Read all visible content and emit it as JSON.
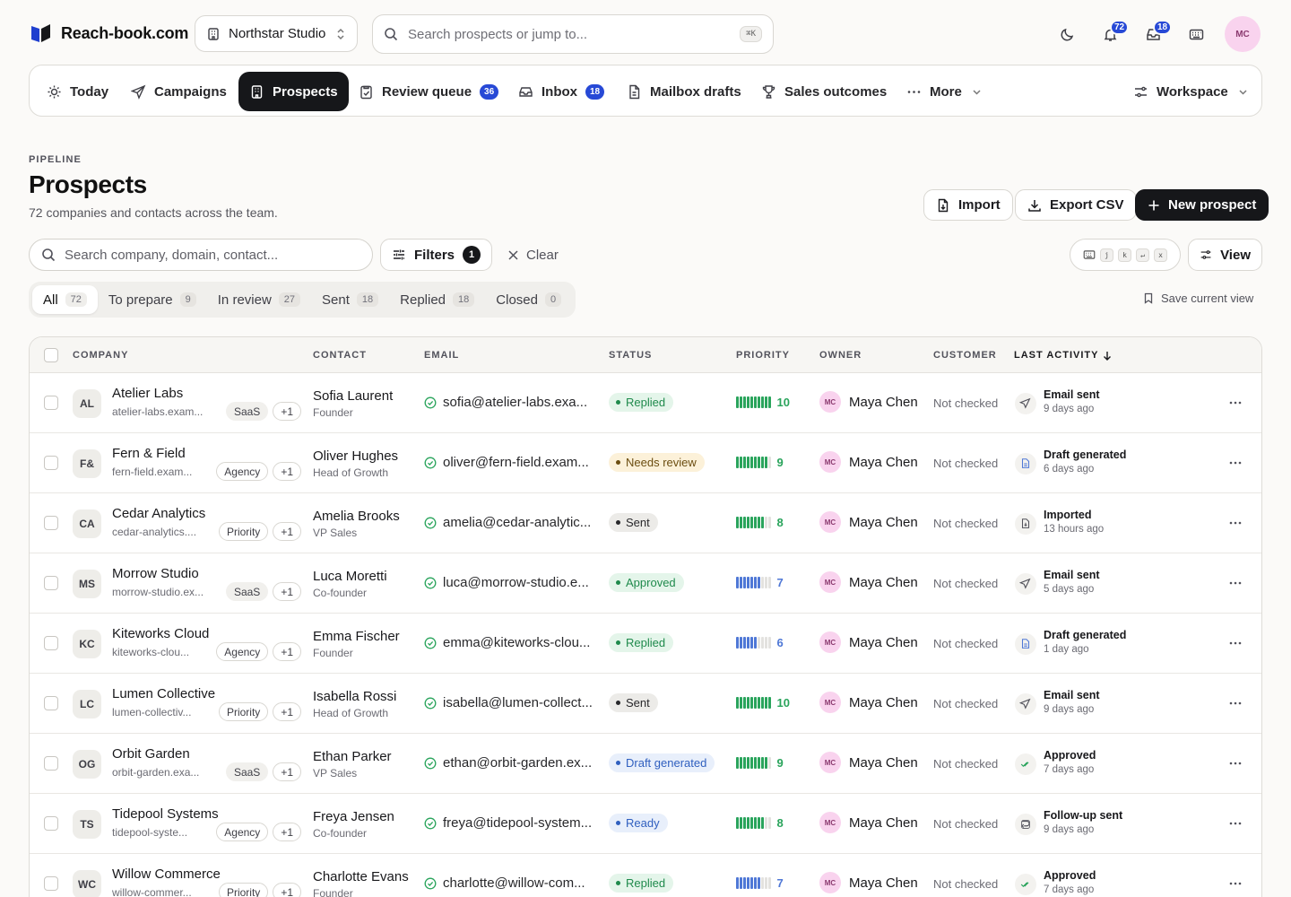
{
  "brand": {
    "name": "Reach-book.com"
  },
  "workspace_switch": {
    "label": "Northstar Studio"
  },
  "top_search": {
    "placeholder": "Search prospects or jump to...",
    "shortcut": "⌘K"
  },
  "top_actions": {
    "notifications_count": "72",
    "inbox_count": "18",
    "avatar_initials": "MC"
  },
  "nav": {
    "items": [
      {
        "label": "Today"
      },
      {
        "label": "Campaigns"
      },
      {
        "label": "Prospects"
      },
      {
        "label": "Review queue",
        "badge": "36"
      },
      {
        "label": "Inbox",
        "badge": "18"
      },
      {
        "label": "Mailbox drafts"
      },
      {
        "label": "Sales outcomes"
      },
      {
        "label": "More"
      }
    ],
    "workspace": "Workspace"
  },
  "header": {
    "eyebrow": "PIPELINE",
    "title": "Prospects",
    "subtitle": "72 companies and contacts across the team.",
    "import_label": "Import",
    "export_label": "Export CSV",
    "new_label": "New prospect"
  },
  "filters": {
    "search_placeholder": "Search company, domain, contact...",
    "filters_label": "Filters",
    "filters_count": "1",
    "clear_label": "Clear",
    "shortcut_keys": [
      "j",
      "k",
      "↵",
      "x"
    ],
    "view_label": "View"
  },
  "segments": [
    {
      "label": "All",
      "count": "72"
    },
    {
      "label": "To prepare",
      "count": "9"
    },
    {
      "label": "In review",
      "count": "27"
    },
    {
      "label": "Sent",
      "count": "18"
    },
    {
      "label": "Replied",
      "count": "18"
    },
    {
      "label": "Closed",
      "count": "0"
    }
  ],
  "save_view_label": "Save current view",
  "table": {
    "columns": {
      "company": "COMPANY",
      "contact": "CONTACT",
      "email": "EMAIL",
      "status": "STATUS",
      "priority": "PRIORITY",
      "owner": "OWNER",
      "customer": "CUSTOMER",
      "last_activity": "LAST ACTIVITY"
    },
    "rows": [
      {
        "initials": "AL",
        "company": "Atelier Labs",
        "domain": "atelier-labs.exam...",
        "tag": "SaaS",
        "extra": "+1",
        "contact": "Sofia Laurent",
        "role": "Founder",
        "email": "sofia@atelier-labs.exa...",
        "status": "Replied",
        "priority": "10",
        "owner_initials": "MC",
        "owner": "Maya Chen",
        "customer": "Not checked",
        "activity": "Email sent",
        "activity_time": "9 days ago"
      },
      {
        "initials": "F&",
        "company": "Fern & Field",
        "domain": "fern-field.exam...",
        "tag": "Agency",
        "extra": "+1",
        "contact": "Oliver Hughes",
        "role": "Head of Growth",
        "email": "oliver@fern-field.exam...",
        "status": "Needs review",
        "priority": "9",
        "owner_initials": "MC",
        "owner": "Maya Chen",
        "customer": "Not checked",
        "activity": "Draft generated",
        "activity_time": "6 days ago"
      },
      {
        "initials": "CA",
        "company": "Cedar Analytics",
        "domain": "cedar-analytics....",
        "tag": "Priority",
        "extra": "+1",
        "contact": "Amelia Brooks",
        "role": "VP Sales",
        "email": "amelia@cedar-analytic...",
        "status": "Sent",
        "priority": "8",
        "owner_initials": "MC",
        "owner": "Maya Chen",
        "customer": "Not checked",
        "activity": "Imported",
        "activity_time": "13 hours ago"
      },
      {
        "initials": "MS",
        "company": "Morrow Studio",
        "domain": "morrow-studio.ex...",
        "tag": "SaaS",
        "extra": "+1",
        "contact": "Luca Moretti",
        "role": "Co-founder",
        "email": "luca@morrow-studio.e...",
        "status": "Approved",
        "priority": "7",
        "owner_initials": "MC",
        "owner": "Maya Chen",
        "customer": "Not checked",
        "activity": "Email sent",
        "activity_time": "5 days ago"
      },
      {
        "initials": "KC",
        "company": "Kiteworks Cloud",
        "domain": "kiteworks-clou...",
        "tag": "Agency",
        "extra": "+1",
        "contact": "Emma Fischer",
        "role": "Founder",
        "email": "emma@kiteworks-clou...",
        "status": "Replied",
        "priority": "6",
        "owner_initials": "MC",
        "owner": "Maya Chen",
        "customer": "Not checked",
        "activity": "Draft generated",
        "activity_time": "1 day ago"
      },
      {
        "initials": "LC",
        "company": "Lumen Collective",
        "domain": "lumen-collectiv...",
        "tag": "Priority",
        "extra": "+1",
        "contact": "Isabella Rossi",
        "role": "Head of Growth",
        "email": "isabella@lumen-collect...",
        "status": "Sent",
        "priority": "10",
        "owner_initials": "MC",
        "owner": "Maya Chen",
        "customer": "Not checked",
        "activity": "Email sent",
        "activity_time": "9 days ago"
      },
      {
        "initials": "OG",
        "company": "Orbit Garden",
        "domain": "orbit-garden.exa...",
        "tag": "SaaS",
        "extra": "+1",
        "contact": "Ethan Parker",
        "role": "VP Sales",
        "email": "ethan@orbit-garden.ex...",
        "status": "Draft generated",
        "priority": "9",
        "owner_initials": "MC",
        "owner": "Maya Chen",
        "customer": "Not checked",
        "activity": "Approved",
        "activity_time": "7 days ago"
      },
      {
        "initials": "TS",
        "company": "Tidepool Systems",
        "domain": "tidepool-syste...",
        "tag": "Agency",
        "extra": "+1",
        "contact": "Freya Jensen",
        "role": "Co-founder",
        "email": "freya@tidepool-system...",
        "status": "Ready",
        "priority": "8",
        "owner_initials": "MC",
        "owner": "Maya Chen",
        "customer": "Not checked",
        "activity": "Follow-up sent",
        "activity_time": "9 days ago"
      },
      {
        "initials": "WC",
        "company": "Willow Commerce",
        "domain": "willow-commer...",
        "tag": "Priority",
        "extra": "+1",
        "contact": "Charlotte Evans",
        "role": "Founder",
        "email": "charlotte@willow-com...",
        "status": "Replied",
        "priority": "7",
        "owner_initials": "MC",
        "owner": "Maya Chen",
        "customer": "Not checked",
        "activity": "Approved",
        "activity_time": "7 days ago"
      }
    ]
  },
  "colors": {
    "accent_blue": "#2749d6",
    "status_replied_bg": "#e4f5ea",
    "status_replied_fg": "#1f8a4c",
    "status_review_bg": "#fcf1d9",
    "status_review_fg": "#6b4d10",
    "status_sent_bg": "#ecebe8",
    "status_sent_fg": "#27272a",
    "status_draft_bg": "#e8effb",
    "status_draft_fg": "#2f5fbf",
    "priority_green": "#2aa45c",
    "priority_blue": "#4f78d6"
  }
}
